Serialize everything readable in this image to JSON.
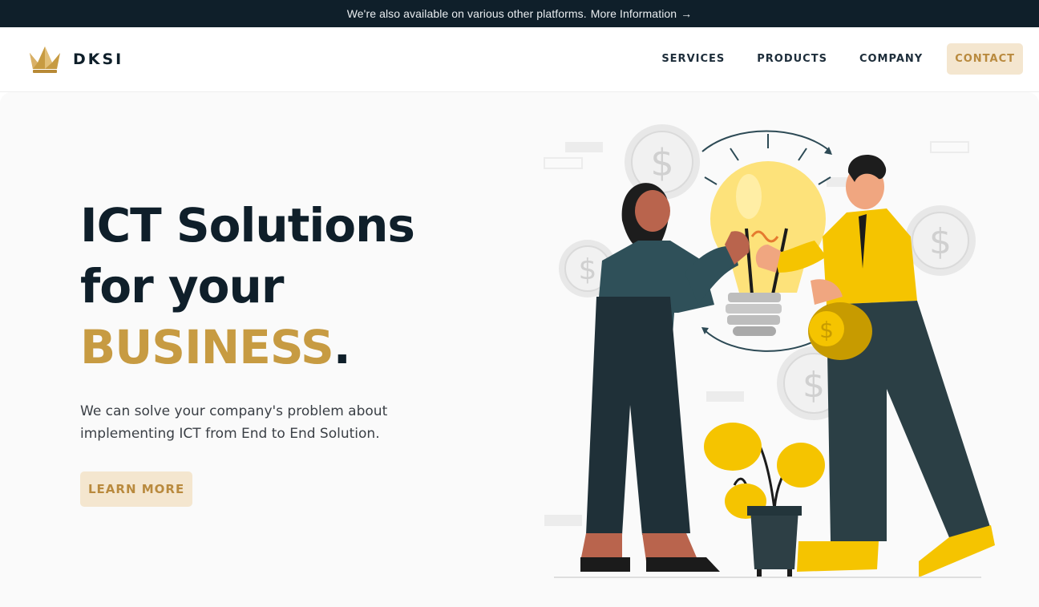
{
  "announcement": {
    "text": "We're also available on various other platforms.",
    "link_text": "More Information",
    "arrow": "→"
  },
  "brand": {
    "name": "DKSI",
    "logo_icon": "crown-icon"
  },
  "nav": {
    "items": [
      {
        "label": "SERVICES"
      },
      {
        "label": "PRODUCTS"
      },
      {
        "label": "COMPANY"
      }
    ],
    "contact_label": "CONTACT"
  },
  "hero": {
    "headline_line1": "ICT Solutions",
    "headline_line2": "for your",
    "headline_accent": "BUSINESS",
    "headline_dot": ".",
    "subtext": "We can solve your company's problem about implementing ICT from End to End Solution.",
    "cta_label": "LEARN MORE"
  },
  "colors": {
    "topbar_bg": "#0f1f2a",
    "accent_gold": "#c79b42",
    "button_bg": "#f4e6cf",
    "button_text": "#b98a3e",
    "illustration_yellow": "#f5c400",
    "illustration_dark": "#1f3a40"
  }
}
